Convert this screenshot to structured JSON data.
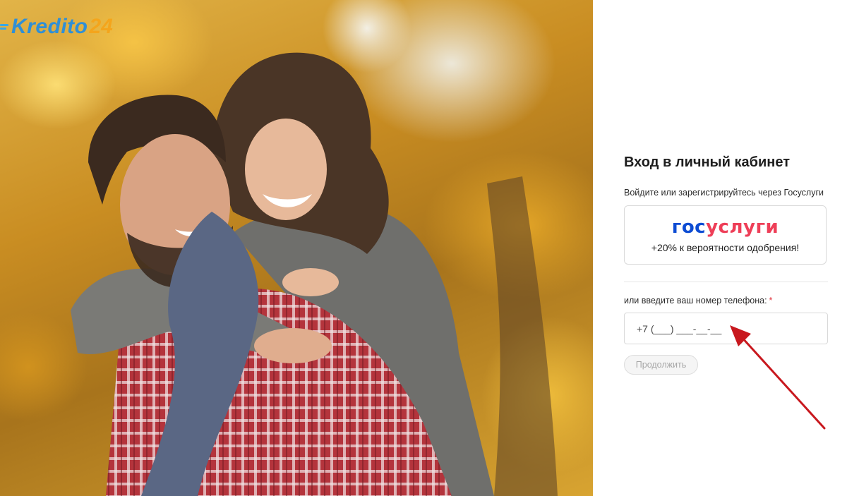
{
  "brand": {
    "logo_text": "Kredito",
    "logo_number": "24"
  },
  "login": {
    "title": "Вход в личный кабинет",
    "gosuslugi_hint": "Войдите или зарегистрируйтесь через Госуслуги",
    "gosuslugi_logo_part1": "гос",
    "gosuslugi_logo_part2": "услуги",
    "gosuslugi_bonus": "+20% к вероятности одобрения!",
    "phone_label": "или введите ваш номер телефона:",
    "required_mark": "*",
    "phone_placeholder": "+7 (___) ___-__-__",
    "continue_label": "Продолжить"
  },
  "colors": {
    "brand_blue": "#2f8fd6",
    "brand_orange": "#f4a51c",
    "gosuslugi_blue": "#0d4cd3",
    "gosuslugi_red": "#ee3f58",
    "annotation_arrow": "#c8181e"
  },
  "icons": {
    "logo_mark": "speed-lines-icon",
    "annotation": "red-arrow-icon"
  }
}
